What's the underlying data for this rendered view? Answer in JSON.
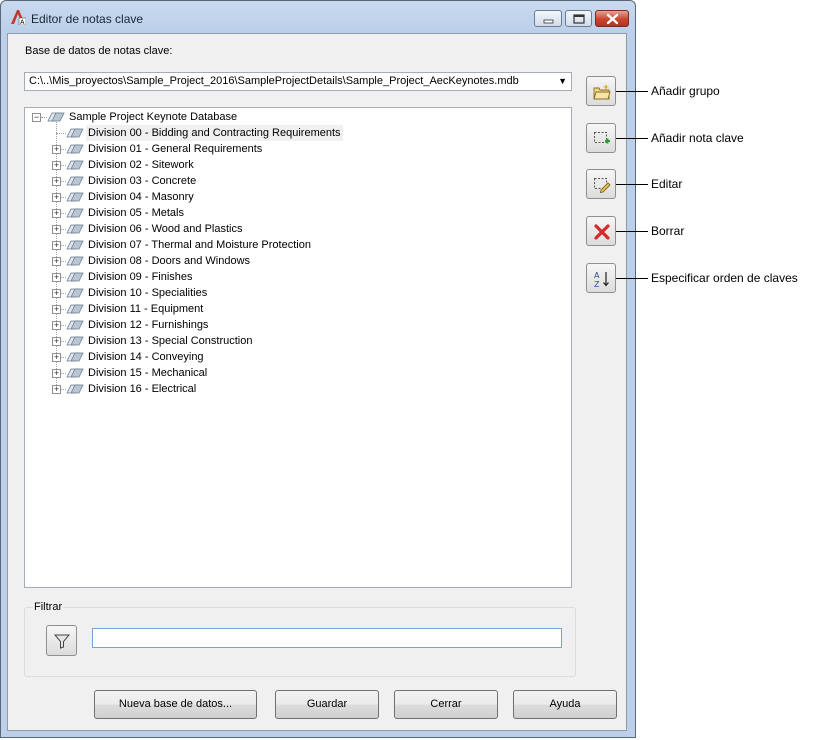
{
  "window": {
    "title": "Editor de notas clave"
  },
  "database": {
    "label": "Base de datos de notas clave:",
    "selected_path": "C:\\..\\Mis_proyectos\\Sample_Project_2016\\SampleProjectDetails\\Sample_Project_AecKeynotes.mdb"
  },
  "tree": {
    "root": "Sample Project Keynote Database",
    "children": [
      "Division 00 - Bidding and Contracting Requirements",
      "Division 01 - General Requirements",
      "Division 02 - Sitework",
      "Division 03 - Concrete",
      "Division 04 - Masonry",
      "Division 05 - Metals",
      "Division 06 - Wood and Plastics",
      "Division 07 - Thermal and Moisture Protection",
      "Division 08 - Doors and Windows",
      "Division 09 - Finishes",
      "Division 10 - Specialities",
      "Division 11 - Equipment",
      "Division 12 - Furnishings",
      "Division 13 - Special Construction",
      "Division 14 - Conveying",
      "Division 15 - Mechanical",
      "Division 16 - Electrical"
    ]
  },
  "side_buttons": [
    {
      "icon": "add-group-icon",
      "callout": "Añadir grupo"
    },
    {
      "icon": "add-keynote-icon",
      "callout": "Añadir nota clave"
    },
    {
      "icon": "edit-icon",
      "callout": "Editar"
    },
    {
      "icon": "delete-icon",
      "callout": "Borrar"
    },
    {
      "icon": "sort-az-icon",
      "callout": "Especificar orden de claves"
    }
  ],
  "filter": {
    "label": "Filtrar",
    "value": ""
  },
  "buttons": {
    "new_db": "Nueva base de datos...",
    "save": "Guardar",
    "close": "Cerrar",
    "help": "Ayuda"
  },
  "colors": {
    "delete_red": "#d42a2a",
    "add_green": "#2e9c2e",
    "title_bar": "#bcd0ea"
  }
}
